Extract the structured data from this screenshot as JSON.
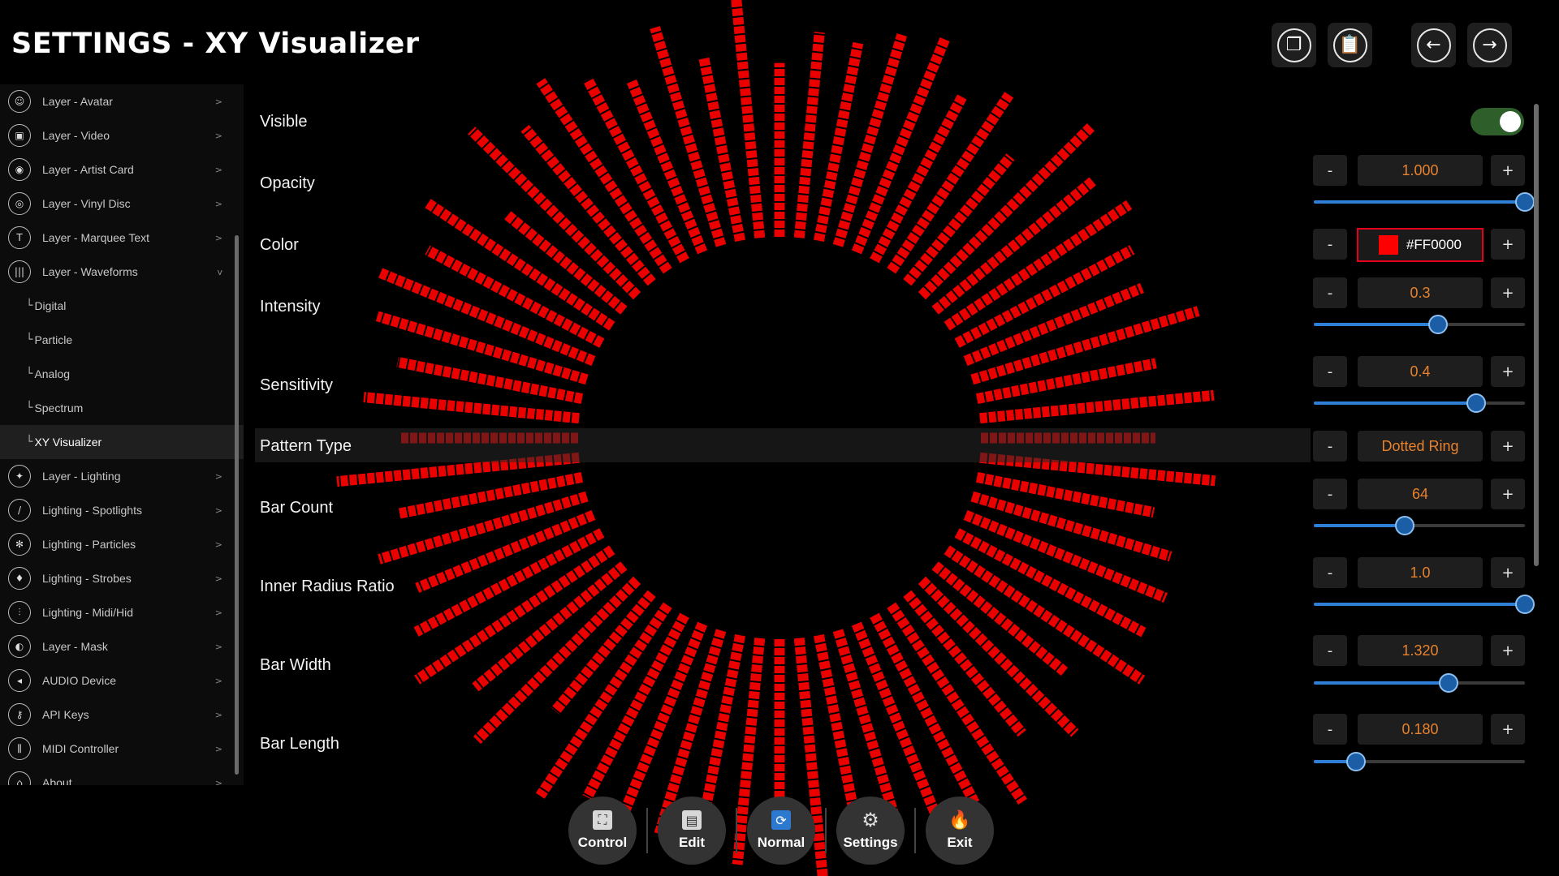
{
  "window": {
    "title": "SETTINGS - XY Visualizer"
  },
  "top_buttons": [
    {
      "name": "copy-button",
      "icon": "copy-icon",
      "glyph": "❐"
    },
    {
      "name": "paste-button",
      "icon": "paste-icon",
      "glyph": "📋"
    },
    {
      "name": "back-button",
      "icon": "arrow-left-icon",
      "glyph": "←"
    },
    {
      "name": "forward-button",
      "icon": "arrow-right-icon",
      "glyph": "→"
    }
  ],
  "sidebar": {
    "items": [
      {
        "label": "Layer - Avatar",
        "icon": "avatar-icon",
        "glyph": "☺",
        "chevron": ">"
      },
      {
        "label": "Layer - Video",
        "icon": "video-icon",
        "glyph": "▣",
        "chevron": ">"
      },
      {
        "label": "Layer - Artist Card",
        "icon": "artist-card-icon",
        "glyph": "◉",
        "chevron": ">"
      },
      {
        "label": "Layer - Vinyl Disc",
        "icon": "vinyl-disc-icon",
        "glyph": "◎",
        "chevron": ">"
      },
      {
        "label": "Layer - Marquee Text",
        "icon": "text-icon",
        "glyph": "T",
        "chevron": ">"
      },
      {
        "label": "Layer - Waveforms",
        "icon": "waveform-icon",
        "glyph": "|||",
        "chevron": "v"
      },
      {
        "label": "Digital",
        "sub": true,
        "branch": "└"
      },
      {
        "label": "Particle",
        "sub": true,
        "branch": "└"
      },
      {
        "label": "Analog",
        "sub": true,
        "branch": "└"
      },
      {
        "label": "Spectrum",
        "sub": true,
        "branch": "└"
      },
      {
        "label": "XY Visualizer",
        "sub": true,
        "branch": "└",
        "active": true
      },
      {
        "label": "Layer - Lighting",
        "icon": "bulb-icon",
        "glyph": "✦",
        "chevron": ">"
      },
      {
        "label": "Lighting - Spotlights",
        "icon": "spotlight-icon",
        "glyph": "/",
        "chevron": ">"
      },
      {
        "label": "Lighting - Particles",
        "icon": "particles-icon",
        "glyph": "✻",
        "chevron": ">"
      },
      {
        "label": "Lighting - Strobes",
        "icon": "strobe-icon",
        "glyph": "♦",
        "chevron": ">"
      },
      {
        "label": "Lighting - Midi/Hid",
        "icon": "midi-hid-icon",
        "glyph": "⫶",
        "chevron": ">"
      },
      {
        "label": "Layer - Mask",
        "icon": "mask-icon",
        "glyph": "◐",
        "chevron": ">"
      },
      {
        "label": "AUDIO Device",
        "icon": "speaker-icon",
        "glyph": "◂",
        "chevron": ">"
      },
      {
        "label": "API Keys",
        "icon": "key-icon",
        "glyph": "⚷",
        "chevron": ">"
      },
      {
        "label": "MIDI Controller",
        "icon": "midi-controller-icon",
        "glyph": "⫼",
        "chevron": ">"
      },
      {
        "label": "About",
        "icon": "about-icon",
        "glyph": "⌂",
        "chevron": ">"
      }
    ]
  },
  "settings": {
    "visible": {
      "label": "Visible",
      "on": true
    },
    "opacity": {
      "label": "Opacity",
      "value": "1.000",
      "level": 1.0
    },
    "color": {
      "label": "Color",
      "value": "#FF0000",
      "swatch": "#FF0000"
    },
    "intensity": {
      "label": "Intensity",
      "value": "0.3",
      "level": 0.59
    },
    "sensitivity": {
      "label": "Sensitivity",
      "value": "0.4",
      "level": 0.77
    },
    "pattern_type": {
      "label": "Pattern Type",
      "value": "Dotted Ring"
    },
    "bar_count": {
      "label": "Bar Count",
      "value": "64",
      "level": 0.43
    },
    "inner_radius_ratio": {
      "label": "Inner Radius Ratio",
      "value": "1.0",
      "level": 1.0
    },
    "bar_width": {
      "label": "Bar Width",
      "value": "1.320",
      "level": 0.64
    },
    "bar_length": {
      "label": "Bar Length",
      "value": "0.180",
      "level": 0.2
    },
    "minus_label": "-",
    "plus_label": "+"
  },
  "dock": [
    {
      "label": "Control",
      "icon": "control-icon",
      "glyph": "⛶"
    },
    {
      "label": "Edit",
      "icon": "edit-icon",
      "glyph": "▤"
    },
    {
      "label": "Normal",
      "icon": "refresh-icon",
      "glyph": "⟳"
    },
    {
      "label": "Settings",
      "icon": "gear-icon",
      "glyph": "⚙"
    },
    {
      "label": "Exit",
      "icon": "fire-icon",
      "glyph": "🔥"
    }
  ],
  "theme": {
    "bar_color": "#FF0000",
    "accent": "#2F7FD6",
    "value_color": "#E8822C"
  }
}
